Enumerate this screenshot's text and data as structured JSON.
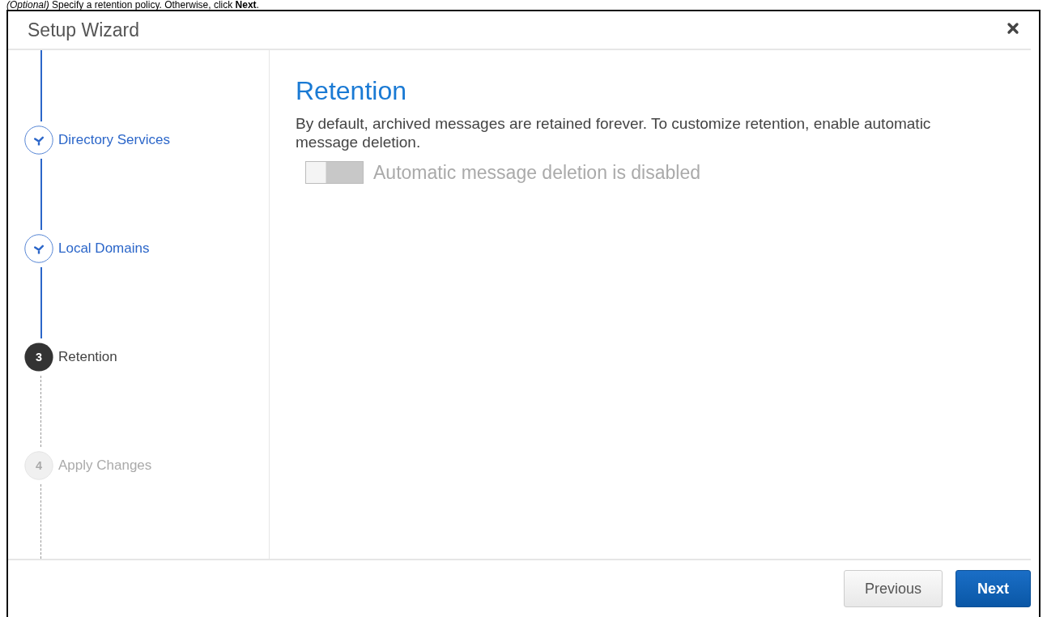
{
  "instruction": "*(Optional)* Specify a retention policy. Otherwise, click **Next**.",
  "window": {
    "title": "Setup Wizard"
  },
  "steps": [
    {
      "label": "Directory Services",
      "kind": "done"
    },
    {
      "label": "Local Domains",
      "kind": "done"
    },
    {
      "number": "3",
      "label": "Retention",
      "kind": "current"
    },
    {
      "number": "4",
      "label": "Apply Changes",
      "kind": "pending"
    }
  ],
  "content": {
    "heading": "Retention",
    "description": "By default, archived messages are retained forever. To customize retention, enable automatic message deletion.",
    "toggle": {
      "label": "Automatic message deletion is disabled",
      "on": false
    }
  },
  "buttons": [
    {
      "label": "Previous",
      "kind": "secondary"
    },
    {
      "label": "Next",
      "kind": "primary"
    }
  ]
}
